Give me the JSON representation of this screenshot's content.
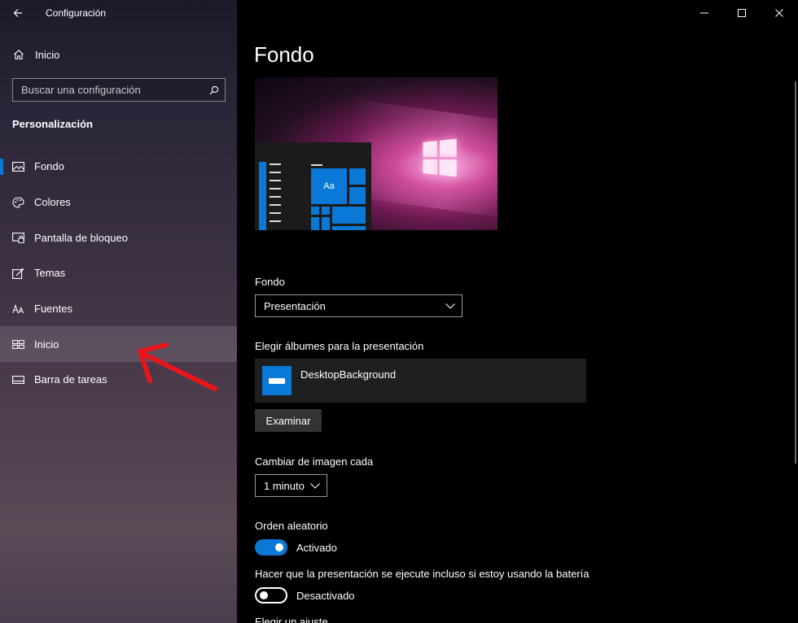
{
  "app": {
    "title": "Configuración"
  },
  "icons": {
    "back": "back-arrow-icon",
    "home": "home-icon",
    "search": "search-icon",
    "minimize": "minimize-icon",
    "maximize": "maximize-icon",
    "close": "close-icon"
  },
  "sidebar": {
    "home_label": "Inicio",
    "search_placeholder": "Buscar una configuración",
    "section_title": "Personalización",
    "items": [
      {
        "label": "Fondo",
        "icon": "picture-icon",
        "selected": true
      },
      {
        "label": "Colores",
        "icon": "palette-icon"
      },
      {
        "label": "Pantalla de bloqueo",
        "icon": "lock-screen-icon"
      },
      {
        "label": "Temas",
        "icon": "themes-icon"
      },
      {
        "label": "Fuentes",
        "icon": "fonts-icon"
      },
      {
        "label": "Inicio",
        "icon": "start-icon",
        "hover": true
      },
      {
        "label": "Barra de tareas",
        "icon": "taskbar-icon"
      }
    ]
  },
  "main": {
    "page_title": "Fondo",
    "preview": {
      "tile_text": "Aa"
    },
    "background_label": "Fondo",
    "background_value": "Presentación",
    "albums_label": "Elegir álbumes para la presentación",
    "album_name": "DesktopBackground",
    "browse_button": "Examinar",
    "change_label": "Cambiar de imagen cada",
    "change_value": "1 minuto",
    "shuffle_label": "Orden aleatorio",
    "shuffle_state": "Activado",
    "battery_label": "Hacer que la presentación se ejecute incluso si estoy usando la batería",
    "battery_state": "Desactivado",
    "fit_label": "Elegir un ajuste"
  },
  "colors": {
    "accent": "#0a78d7",
    "annotation_arrow": "#e8161b"
  }
}
